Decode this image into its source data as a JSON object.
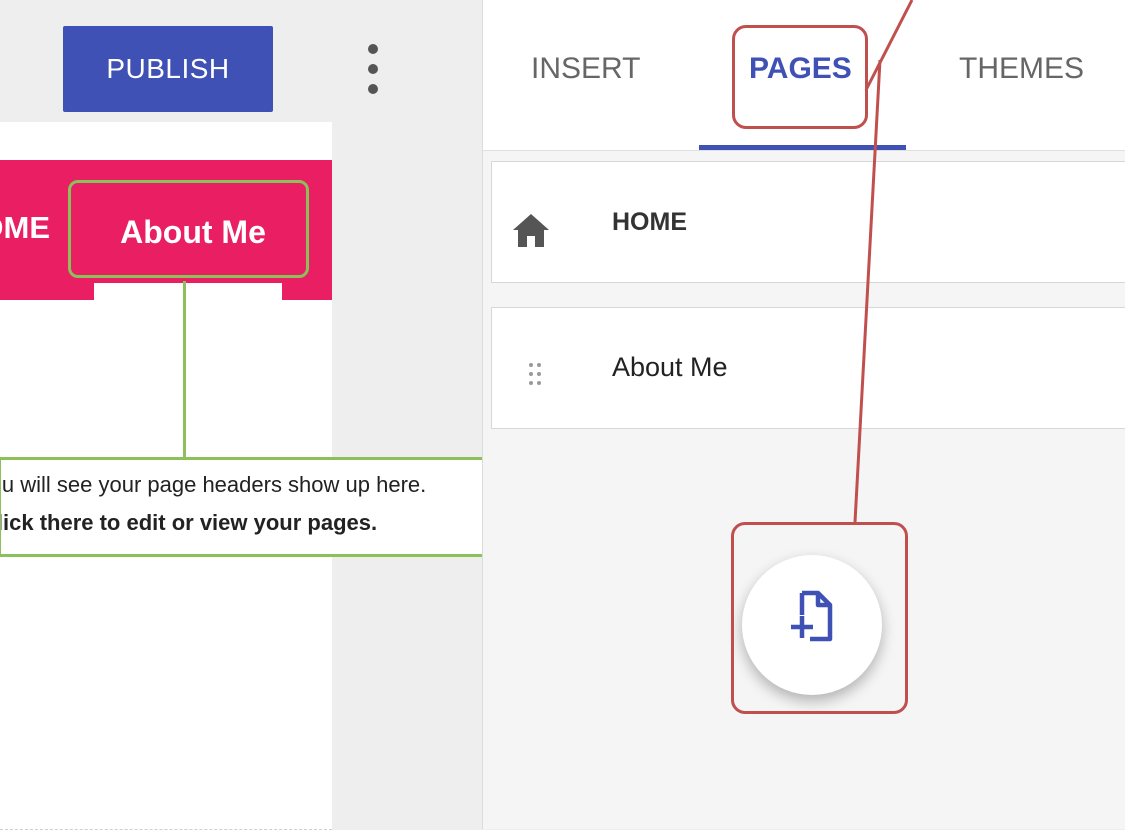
{
  "editor": {
    "publish_label": "PUBLISH",
    "more_menu_icon": "more-vert-icon"
  },
  "site_nav": {
    "home_label": "HOME",
    "about_label": "About Me"
  },
  "callout": {
    "line1": "You will see your page headers show up here.",
    "line2": "Click there to edit or view your pages."
  },
  "panel": {
    "tabs": [
      {
        "label": "INSERT",
        "selected": false
      },
      {
        "label": "PAGES",
        "selected": true
      },
      {
        "label": "THEMES",
        "selected": false
      }
    ],
    "pages": [
      {
        "label": "HOME",
        "icon": "home-icon"
      },
      {
        "label": "About Me",
        "icon": "drag-handle-icon"
      }
    ],
    "fab_icon": "add-page-icon"
  },
  "colors": {
    "accent": "#3f51b5",
    "nav_bar": "#e91e63",
    "annotation_green": "#8bc05a",
    "annotation_red": "#c0504d"
  }
}
